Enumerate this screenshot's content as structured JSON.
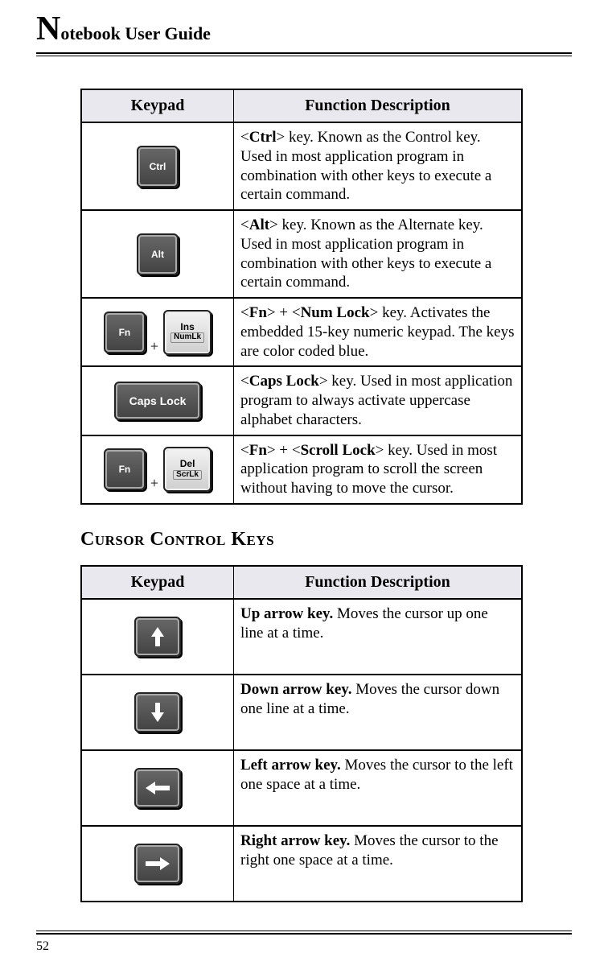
{
  "header": {
    "title": "Notebook User Guide"
  },
  "table1": {
    "h1": "Keypad",
    "h2": "Function Description",
    "rows": [
      {
        "desc_pre": "<",
        "k1": "Ctrl",
        "desc_post": "> key. Known as the Control key. Used in most application program in combination with other keys to execute a certain command."
      },
      {
        "desc_pre": "<",
        "k1": "Alt",
        "desc_post": "> key. Known as the Alternate key. Used in most application program in combination with other keys to execute a certain command."
      },
      {
        "desc_pre": "<",
        "k1": "Fn",
        "mid": "> + <",
        "k2": "Num Lock",
        "desc_post": "> key. Activates the embedded 15-key numeric keypad. The keys are color coded blue."
      },
      {
        "desc_pre": "<",
        "k1": "Caps Lock",
        "desc_post": "> key. Used in most application program to always activate uppercase alphabet characters."
      },
      {
        "desc_pre": "<",
        "k1": "Fn",
        "mid": "> + <",
        "k2": "Scroll Lock",
        "desc_post": "> key. Used in most application program to scroll the screen without having to move the cursor."
      }
    ]
  },
  "section2": {
    "title": "Cursor Control Keys"
  },
  "table2": {
    "h1": "Keypad",
    "h2": "Function Description",
    "rows": [
      {
        "k": "Up arrow key.",
        "d": " Moves the cursor up one line at a time."
      },
      {
        "k": "Down arrow key.",
        "d": " Moves the cursor down one line at a time."
      },
      {
        "k": "Left arrow key.",
        "d": " Moves the cursor to the left one space at a time."
      },
      {
        "k": "Right arrow key.",
        "d": " Moves the cursor to the right one space at a time."
      }
    ]
  },
  "keycaps": {
    "ctrl": "Ctrl",
    "alt": "Alt",
    "fn": "Fn",
    "ins": "Ins",
    "numlk": "NumLk",
    "caps": "Caps Lock",
    "del": "Del",
    "scrlk": "ScrLk"
  },
  "footer": {
    "page": "52"
  }
}
